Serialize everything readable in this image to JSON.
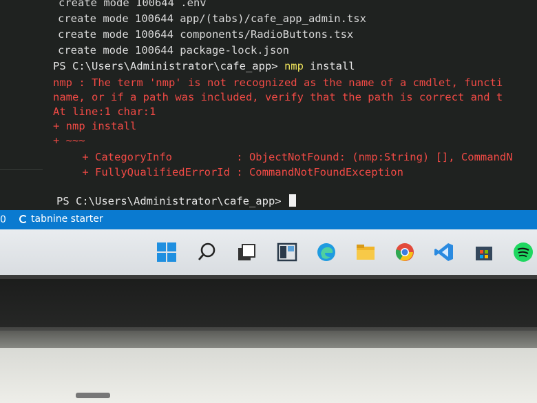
{
  "terminal": {
    "lines": [
      "create mode 100644 .env",
      "create mode 100644 app/(tabs)/cafe_app_admin.tsx",
      "create mode 100644 components/RadioButtons.tsx",
      "create mode 100644 package-lock.json"
    ],
    "prompt1": "PS C:\\Users\\Administrator\\cafe_app> ",
    "command": "nmp",
    "command_arg": " install",
    "errors": [
      "nmp : The term 'nmp' is not recognized as the name of a cmdlet, functi",
      "name, or if a path was included, verify that the path is correct and t",
      "At line:1 char:1",
      "+ nmp install",
      "+ ~~~",
      "    + CategoryInfo          : ObjectNotFound: (nmp:String) [], CommandN",
      "    + FullyQualifiedErrorId : CommandNotFoundException"
    ],
    "prompt2": "PS C:\\Users\\Administrator\\cafe_app> "
  },
  "statusbar": {
    "left_value": "0",
    "extension_label": "tabnine starter",
    "bg_color": "#0a7ad0"
  },
  "taskbar": {
    "icons": [
      "windows-start-icon",
      "search-icon",
      "task-view-icon",
      "widgets-icon",
      "edge-browser-icon",
      "file-explorer-icon",
      "chrome-browser-icon",
      "vscode-icon",
      "store-icon",
      "spotify-icon"
    ]
  }
}
